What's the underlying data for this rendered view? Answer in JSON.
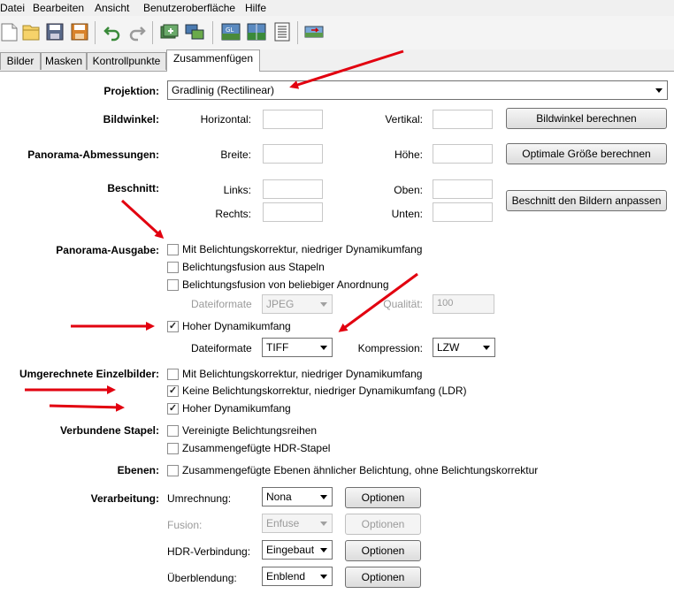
{
  "menubar": {
    "items": [
      "Datei",
      "Bearbeiten",
      "Ansicht",
      "Benutzeroberfläche",
      "Hilfe"
    ]
  },
  "tabs": [
    "Bilder",
    "Masken",
    "Kontrollpunkte",
    "Zusammenfügen"
  ],
  "projection": {
    "label": "Projektion:",
    "value": "Gradlinig (Rectilinear)"
  },
  "fov": {
    "label": "Bildwinkel:",
    "horizontal_label": "Horizontal:",
    "vertical_label": "Vertikal:",
    "button": "Bildwinkel berechnen"
  },
  "size": {
    "label": "Panorama-Abmessungen:",
    "width_label": "Breite:",
    "height_label": "Höhe:",
    "button": "Optimale Größe berechnen"
  },
  "crop": {
    "label": "Beschnitt:",
    "left_label": "Links:",
    "right_label": "Rechts:",
    "top_label": "Oben:",
    "bottom_label": "Unten:",
    "button": "Beschnitt den Bildern anpassen"
  },
  "panorama_output": {
    "label": "Panorama-Ausgabe:",
    "options": [
      {
        "label": "Mit Belichtungskorrektur, niedriger Dynamikumfang",
        "checked": false
      },
      {
        "label": "Belichtungsfusion aus Stapeln",
        "checked": false
      },
      {
        "label": "Belichtungsfusion von beliebiger Anordnung",
        "checked": false
      }
    ],
    "ldr_format_label": "Dateiformate",
    "ldr_format_value": "JPEG",
    "quality_label": "Qualität:",
    "quality_value": "100",
    "hdr": {
      "label": "Hoher Dynamikumfang",
      "checked": true
    },
    "hdr_format_label": "Dateiformate",
    "hdr_format_value": "TIFF",
    "compression_label": "Kompression:",
    "compression_value": "LZW"
  },
  "remapped": {
    "label": "Umgerechnete Einzelbilder:",
    "options": [
      {
        "label": "Mit Belichtungskorrektur, niedriger Dynamikumfang",
        "checked": false
      },
      {
        "label": "Keine Belichtungskorrektur, niedriger Dynamikumfang (LDR)",
        "checked": true
      },
      {
        "label": "Hoher Dynamikumfang",
        "checked": true
      }
    ]
  },
  "stacks": {
    "label": "Verbundene Stapel:",
    "options": [
      {
        "label": "Vereinigte Belichtungsreihen",
        "checked": false
      },
      {
        "label": "Zusammengefügte HDR-Stapel",
        "checked": false
      }
    ]
  },
  "layers": {
    "label": "Ebenen:",
    "option": {
      "label": "Zusammengefügte Ebenen ähnlicher Belichtung, ohne Belichtungskorrektur",
      "checked": false
    }
  },
  "processing": {
    "label": "Verarbeitung:",
    "rows": [
      {
        "label": "Umrechnung:",
        "value": "Nona",
        "button": "Optionen",
        "disabled": false
      },
      {
        "label": "Fusion:",
        "value": "Enfuse",
        "button": "Optionen",
        "disabled": true
      },
      {
        "label": "HDR-Verbindung:",
        "value": "Eingebaut",
        "button": "Optionen",
        "disabled": false
      },
      {
        "label": "Überblendung:",
        "value": "Enblend",
        "button": "Optionen",
        "disabled": false
      }
    ]
  },
  "colors": {
    "annotation_arrow": "#e2000f"
  },
  "icons": [
    "new-project-icon",
    "open-project-icon",
    "save-icon",
    "save-as-icon",
    "undo-icon",
    "redo-icon",
    "add-images-icon",
    "align-icon",
    "preview-gl-icon",
    "preview-icon",
    "batch-list-icon",
    "stitch-icon"
  ]
}
